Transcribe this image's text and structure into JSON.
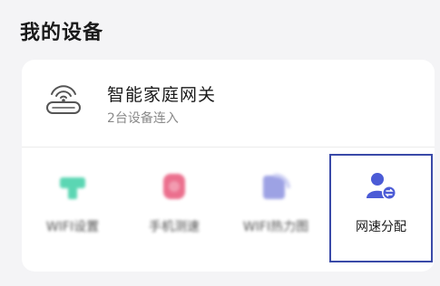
{
  "section": {
    "title": "我的设备"
  },
  "gateway": {
    "name": "智能家庭网关",
    "subtitle": "2台设备连入",
    "icon": "router-icon"
  },
  "tools": [
    {
      "label": "WIFI设置",
      "icon": "wifi-settings-icon",
      "color": "#3fcfa6"
    },
    {
      "label": "手机测速",
      "icon": "speed-test-icon",
      "color": "#e8577a"
    },
    {
      "label": "WIFI热力图",
      "icon": "wifi-heatmap-icon",
      "color": "#8d92e0"
    },
    {
      "label": "网速分配",
      "icon": "speed-allocation-icon",
      "color": "#4b5bd6"
    }
  ]
}
